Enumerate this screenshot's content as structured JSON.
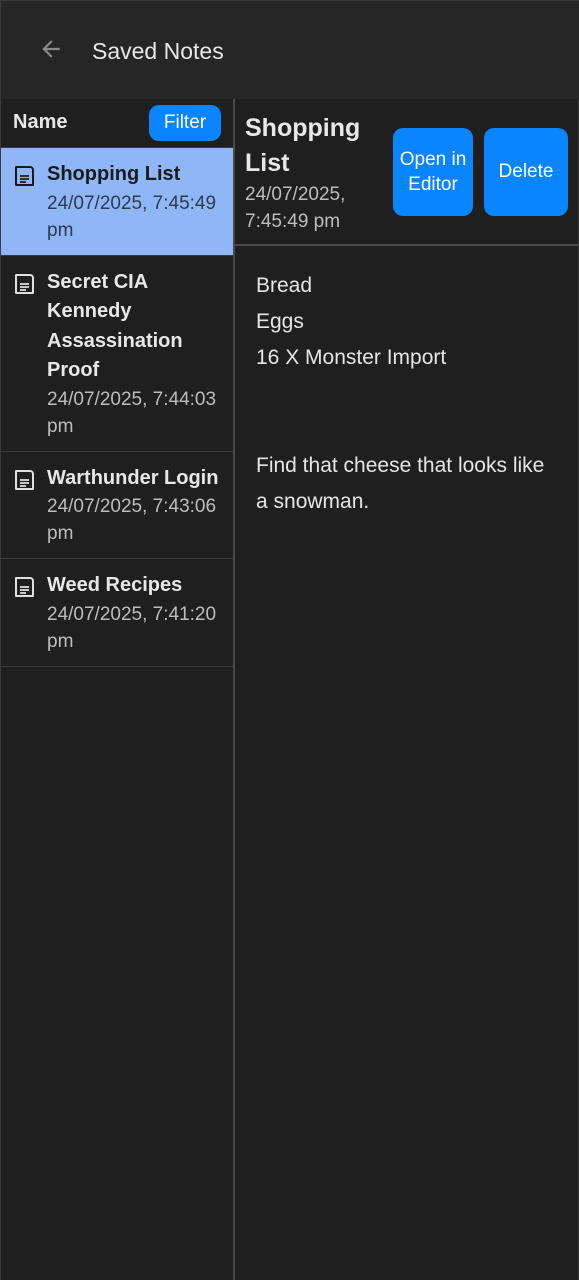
{
  "app_bar": {
    "title": "Saved Notes"
  },
  "list": {
    "header_label": "Name",
    "filter_label": "Filter",
    "notes": [
      {
        "title": "Shopping List",
        "date": "24/07/2025, 7:45:49 pm",
        "selected": true
      },
      {
        "title": "Secret CIA Kennedy Assassination Proof",
        "date": "24/07/2025, 7:44:03 pm",
        "selected": false
      },
      {
        "title": "Warthunder Login",
        "date": "24/07/2025, 7:43:06 pm",
        "selected": false
      },
      {
        "title": "Weed Recipes",
        "date": "24/07/2025, 7:41:20 pm",
        "selected": false
      }
    ]
  },
  "detail": {
    "title": "Shopping List",
    "date": "24/07/2025, 7:45:49 pm",
    "open_label": "Open in Editor",
    "delete_label": "Delete",
    "content_lines": [
      "Bread",
      "Eggs",
      "16 X Monster Import",
      "",
      "",
      "Find that cheese that looks like a snowman."
    ]
  },
  "colors": {
    "accent": "#0a84ff",
    "selected_row": "#8fb7f8",
    "background": "#1f1f1f"
  },
  "icons": {
    "back": "arrow-left-icon",
    "note": "document-icon"
  }
}
